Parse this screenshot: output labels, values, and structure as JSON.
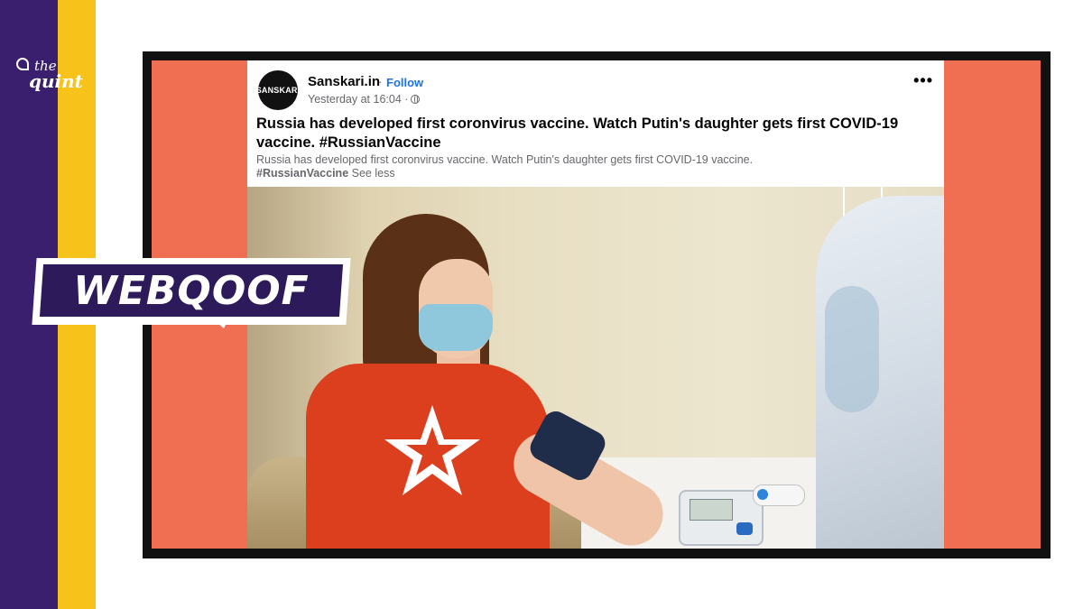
{
  "brand": {
    "logo_line1": "the",
    "logo_line2": "quint",
    "stripe_colors": [
      "#3a1f6e",
      "#f7c21a"
    ],
    "accent_coral": "#f06e52"
  },
  "badge": {
    "label": "WEBQOOF"
  },
  "post": {
    "avatar_text": "SANSKARI",
    "page_name": "Sanskari.in",
    "separator": "·",
    "follow_label": "Follow",
    "timestamp": "Yesterday at 16:04 ·",
    "audience_icon": "globe-icon",
    "more_icon": "more-options-icon",
    "more_label": "•••",
    "headline": "Russia has developed first coronvirus vaccine. Watch Putin's daughter gets first COVID-19 vaccine. #RussianVaccine",
    "description": "Russia has developed first coronvirus vaccine. Watch Putin's daughter gets first COVID-19 vaccine.",
    "hashtag": "#RussianVaccine",
    "see_less": "See less"
  }
}
